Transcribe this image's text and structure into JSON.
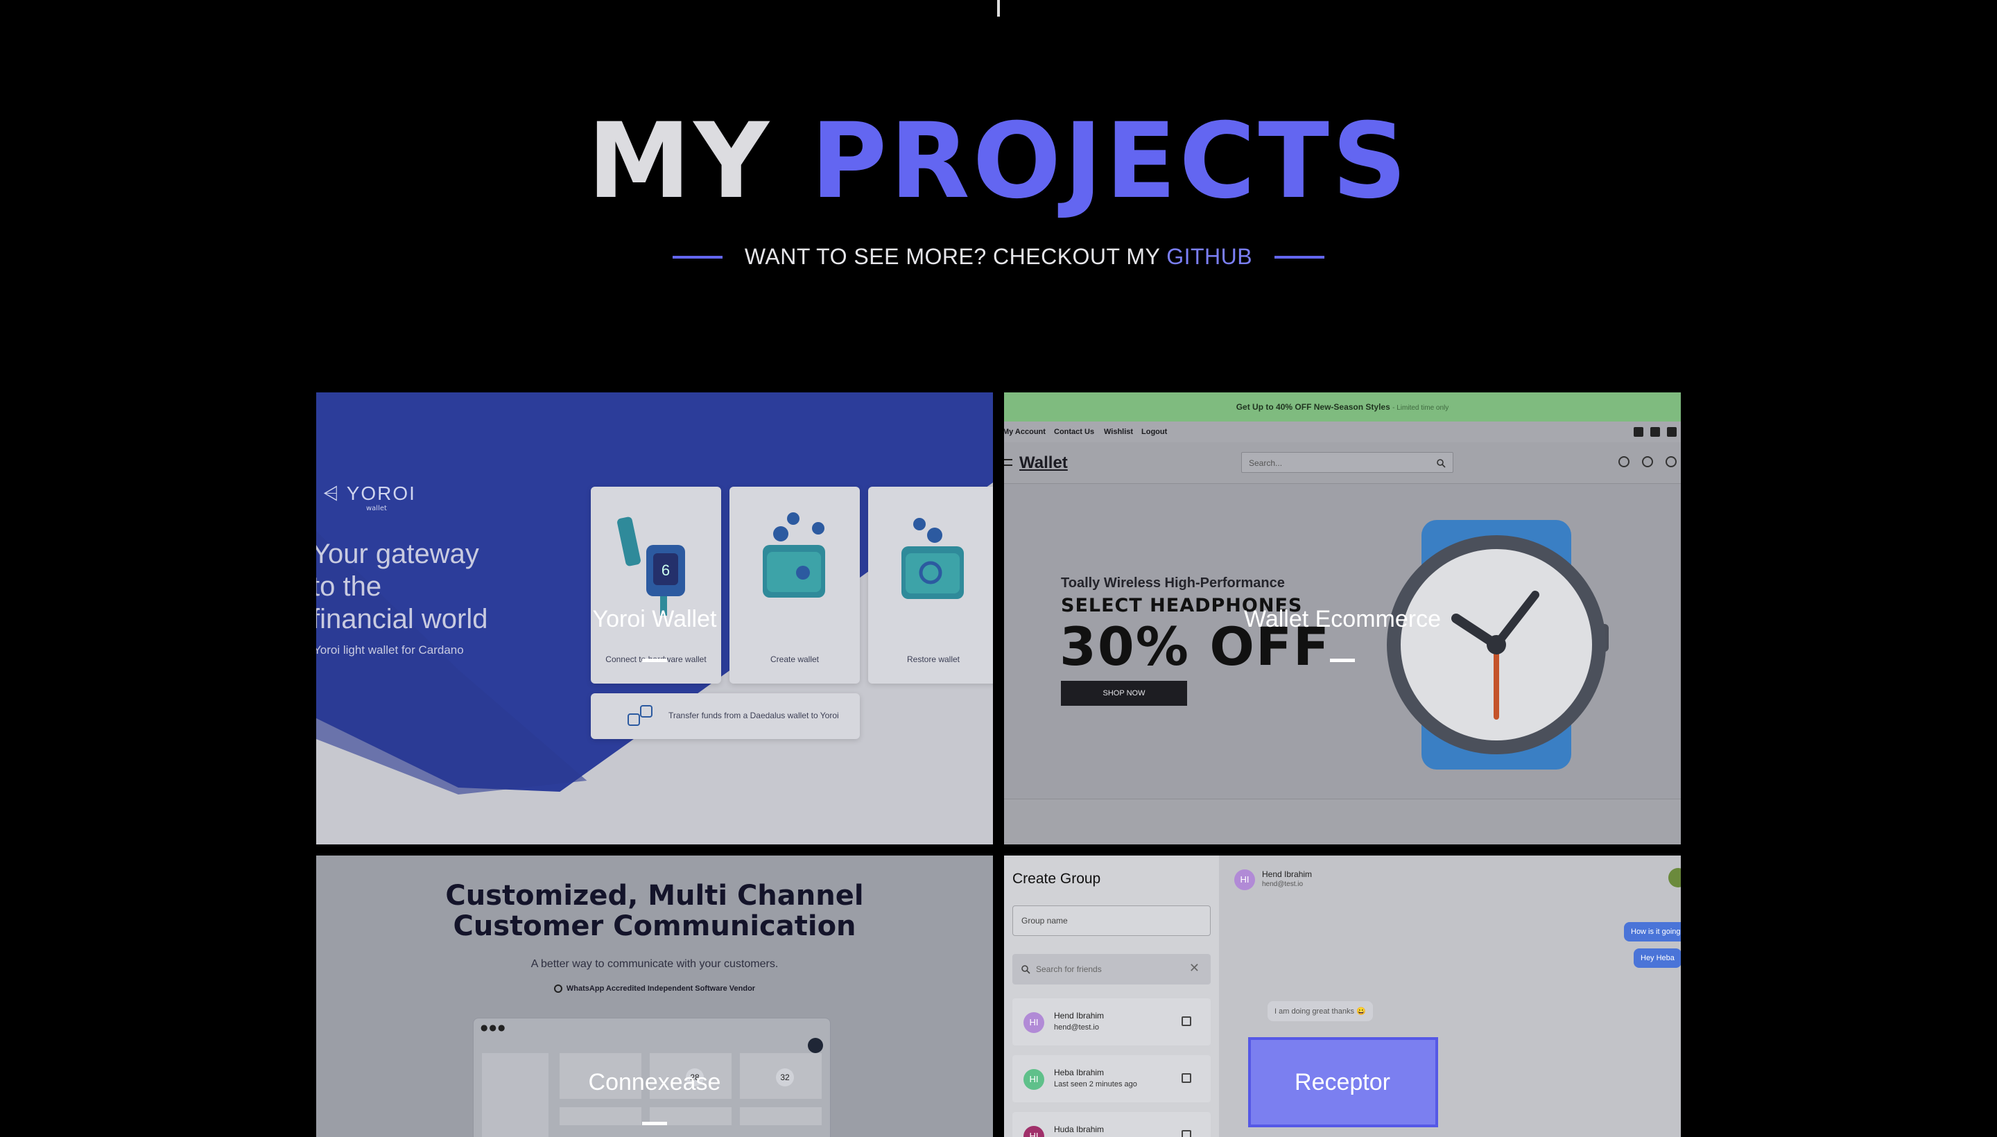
{
  "heading": {
    "word1": "MY",
    "word2": "PROJECTS"
  },
  "subtitle": {
    "prefix": "WANT TO SEE MORE? CHECKOUT MY",
    "link": "GITHUB"
  },
  "colors": {
    "accent": "#6366f1",
    "background": "#000000"
  },
  "projects": [
    {
      "title": "Yoroi Wallet",
      "screenshot": {
        "logo": "YOROI",
        "logo_sub": "wallet",
        "tagline_lines": [
          "Your gateway",
          "to the",
          "financial world"
        ],
        "tagline_sub": "Yoroi light wallet for Cardano",
        "options": [
          "Connect to hardware wallet",
          "Create wallet",
          "Restore wallet"
        ],
        "transfer": "Transfer funds from a Daedalus wallet to Yoroi"
      }
    },
    {
      "title": "Wallet Ecommerce",
      "screenshot": {
        "promo": "Get Up to 40% OFF New-Season Styles",
        "promo_limited": "- Limited time only",
        "top_links": [
          "My Account",
          "Contact Us",
          "Wishlist",
          "Logout"
        ],
        "brand": "Wallet",
        "search_placeholder": "Search...",
        "hero_sub": "Toally Wireless High-Performance",
        "hero_h1": "SELECT HEADPHONES",
        "hero_big": "30% OFF",
        "shop_button": "SHOP NOW"
      }
    },
    {
      "title": "Connexease",
      "screenshot": {
        "headline_lines": [
          "Customized, Multi Channel",
          "Customer Communication"
        ],
        "paragraph": "A better way to communicate with your customers.",
        "badge": "WhatsApp Accredited Independent Software Vendor",
        "tile_numbers": [
          "28",
          "32"
        ]
      }
    },
    {
      "title": "Receptor",
      "screenshot": {
        "panel_title": "Create Group",
        "group_name_placeholder": "Group name",
        "search_placeholder": "Search for friends",
        "friends": [
          {
            "initials": "HI",
            "name": "Hend Ibrahim",
            "sub": "hend@test.io",
            "color": "#b18ad6"
          },
          {
            "initials": "HI",
            "name": "Heba Ibrahim",
            "sub": "Last seen 2 minutes ago",
            "color": "#5fc08a"
          },
          {
            "initials": "HI",
            "name": "Huda Ibrahim",
            "sub": "",
            "color": "#a0306a"
          }
        ],
        "chat_name": "Hend Ibrahim",
        "chat_email": "hend@test.io",
        "messages_out": [
          "How is it going",
          "Hey Heba"
        ],
        "message_in": "I am doing great thanks 😀"
      }
    }
  ]
}
